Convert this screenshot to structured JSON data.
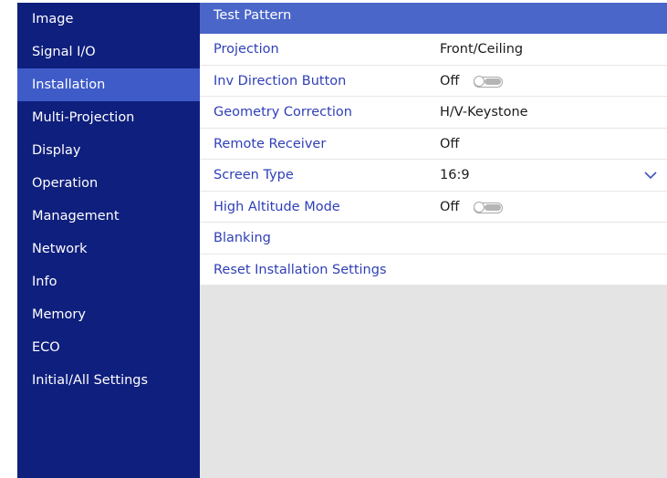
{
  "sidebar": {
    "items": [
      {
        "label": "Image"
      },
      {
        "label": "Signal I/O"
      },
      {
        "label": "Installation"
      },
      {
        "label": "Multi-Projection"
      },
      {
        "label": "Display"
      },
      {
        "label": "Operation"
      },
      {
        "label": "Management"
      },
      {
        "label": "Network"
      },
      {
        "label": "Info"
      },
      {
        "label": "Memory"
      },
      {
        "label": "ECO"
      },
      {
        "label": "Initial/All Settings"
      }
    ],
    "active": "Installation"
  },
  "main": {
    "header": {
      "label": "Test Pattern"
    },
    "rows": [
      {
        "label": "Projection",
        "value": "Front/Ceiling"
      },
      {
        "label": "Inv Direction Button",
        "value": "Off",
        "toggle": "off"
      },
      {
        "label": "Geometry Correction",
        "value": "H/V-Keystone"
      },
      {
        "label": "Remote Receiver",
        "value": "Off"
      },
      {
        "label": "Screen Type",
        "value": "16:9",
        "icon": "chevron-down-icon"
      },
      {
        "label": "High Altitude Mode",
        "value": "Off",
        "toggle": "off"
      },
      {
        "label": "Blanking",
        "value": ""
      },
      {
        "label": "Reset Installation Settings",
        "value": ""
      }
    ]
  },
  "colors": {
    "sidebar_bg": "#0f1f7d",
    "sidebar_active": "#3e5bc8",
    "header_bg": "#4a66c8",
    "label_text": "#2f3fb7",
    "panel_bg": "#e4e4e4"
  }
}
